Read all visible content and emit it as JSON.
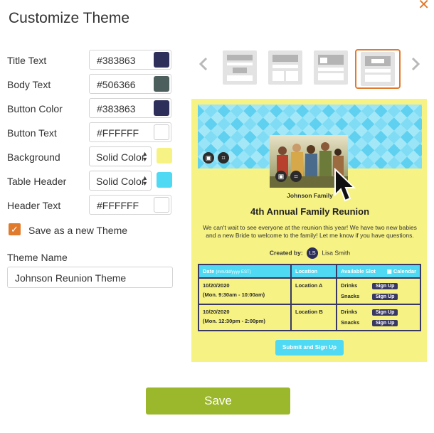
{
  "dialog": {
    "title": "Customize Theme"
  },
  "settings": [
    {
      "label": "Title Text",
      "value": "#383863",
      "swatch": "#2d2f5a"
    },
    {
      "label": "Body Text",
      "value": "#506366",
      "swatch": "#4c5f5d"
    },
    {
      "label": "Button Color",
      "value": "#383863",
      "swatch": "#2d2f5a"
    },
    {
      "label": "Button Text",
      "value": "#FFFFFF",
      "swatch": "#ffffff"
    },
    {
      "label": "Background",
      "value": "Solid Color",
      "swatch": "#f6f283"
    },
    {
      "label": "Table Header",
      "value": "Solid Color",
      "swatch": "#4fd9f2"
    },
    {
      "label": "Header Text",
      "value": "#FFFFFF",
      "swatch": "#ffffff"
    }
  ],
  "save_new_theme": {
    "label": "Save as a new Theme",
    "checked": true
  },
  "theme_name": {
    "label": "Theme Name",
    "value": "Johnson Reunion Theme"
  },
  "layouts": {
    "selected_index": 3
  },
  "preview": {
    "host_name": "Johnson Family",
    "event_title": "4th Annual Family Reunion",
    "description": "We can't wait to see everyone at the reunion this year! We have two new babies and a new Bride to welcome to the family! Let me know if you have questions.",
    "created_by_label": "Created by:",
    "creator_initials": "LS",
    "creator_name": "Lisa Smith",
    "table": {
      "headers": {
        "date": "Date",
        "date_hint": "(mm/dd/yyyy EST)",
        "location": "Location",
        "slot": "Available Slot",
        "calendar": "Calendar"
      },
      "rows": [
        {
          "date": "10/20/2020",
          "time": "(Mon. 9:30am - 10:00am)",
          "location": "Location A",
          "slot1": "Drinks",
          "slot2": "Snacks"
        },
        {
          "date": "10/20/2020",
          "time": "(Mon. 12:30pm - 2:00pm)",
          "location": "Location B",
          "slot1": "Drinks",
          "slot2": "Snacks"
        }
      ],
      "signup_label": "Sign Up"
    },
    "submit_label": "Submit and Sign Up"
  },
  "save_button": {
    "label": "Save"
  }
}
